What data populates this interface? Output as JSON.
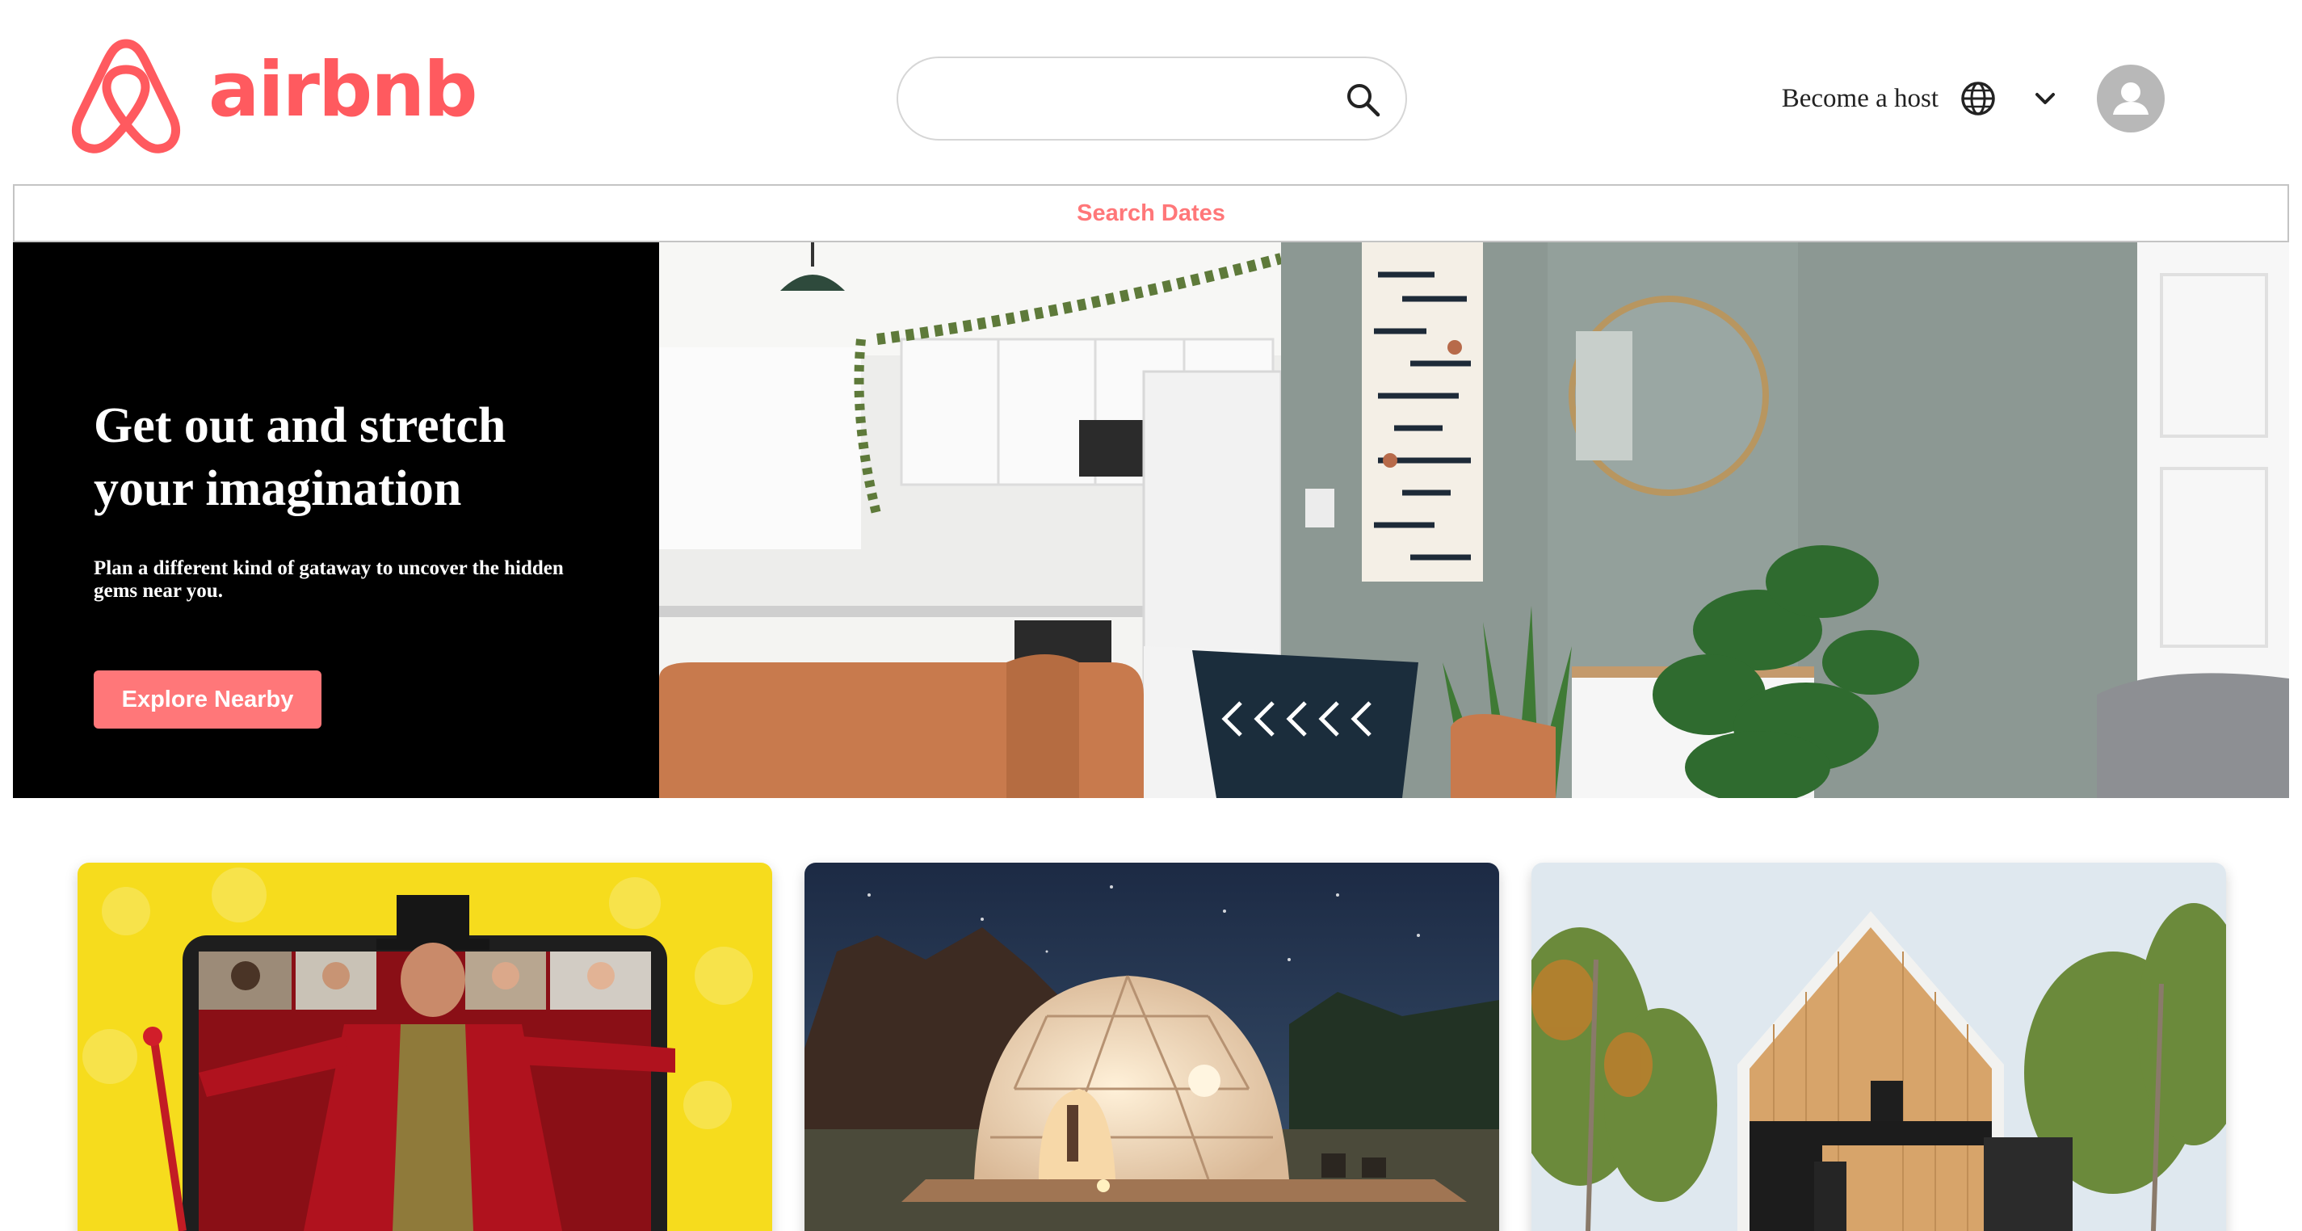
{
  "header": {
    "brand": "airbnb",
    "brand_color": "#ff5a5f",
    "search": {
      "value": "",
      "placeholder": "",
      "icon": "search-icon"
    },
    "host_link": "Become a host",
    "globe_icon": "globe-icon",
    "menu_icon": "chevron-down-icon",
    "avatar_icon": "user-avatar-icon"
  },
  "dates_bar": {
    "label": "Search Dates",
    "color": "#ff7779"
  },
  "hero": {
    "title": "Get out and stretch your imagination",
    "subtitle": "Plan a different kind of gataway to uncover the hidden gems near you.",
    "button_label": "Explore Nearby",
    "button_color": "#ff7779"
  },
  "cards": [
    {
      "image": "online-experience-ringmaster"
    },
    {
      "image": "glamping-dome-night"
    },
    {
      "image": "wooden-cabin-forest"
    }
  ]
}
